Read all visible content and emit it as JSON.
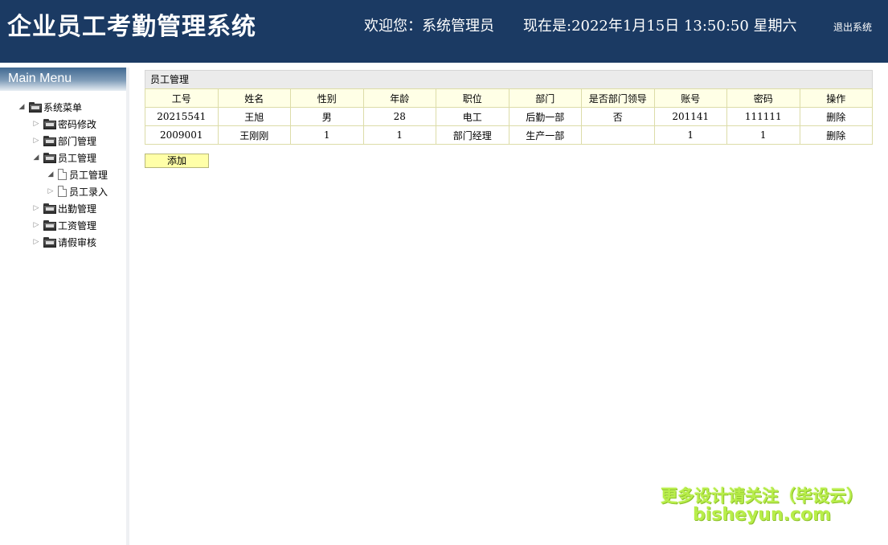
{
  "header": {
    "title": "企业员工考勤管理系统",
    "welcome": "欢迎您：系统管理员",
    "datetime": "现在是:2022年1月15日 13:50:50 星期六",
    "logout_label": "退出系统",
    "bg_color": "#1b3a63"
  },
  "sidebar": {
    "heading": "Main Menu",
    "root_label": "系统菜单",
    "items": [
      {
        "label": "密码修改"
      },
      {
        "label": "部门管理"
      },
      {
        "label": "员工管理",
        "children": [
          {
            "label": "员工管理"
          },
          {
            "label": "员工录入"
          }
        ]
      },
      {
        "label": "出勤管理"
      },
      {
        "label": "工资管理"
      },
      {
        "label": "请假审核"
      }
    ]
  },
  "main": {
    "panel_title": "员工管理",
    "columns": [
      "工号",
      "姓名",
      "性别",
      "年龄",
      "职位",
      "部门",
      "是否部门领导",
      "账号",
      "密码",
      "操作"
    ],
    "rows": [
      [
        "20215541",
        "王旭",
        "男",
        "28",
        "电工",
        "后勤一部",
        "否",
        "201141",
        "111111",
        "删除"
      ],
      [
        "2009001",
        "王刚刚",
        "1",
        "1",
        "部门经理",
        "生产一部",
        "",
        "1",
        "1",
        "删除"
      ]
    ],
    "add_label": "添加"
  },
  "watermark": {
    "line1": "更多设计请关注（毕设云）",
    "line2": "bisheyun.com"
  }
}
